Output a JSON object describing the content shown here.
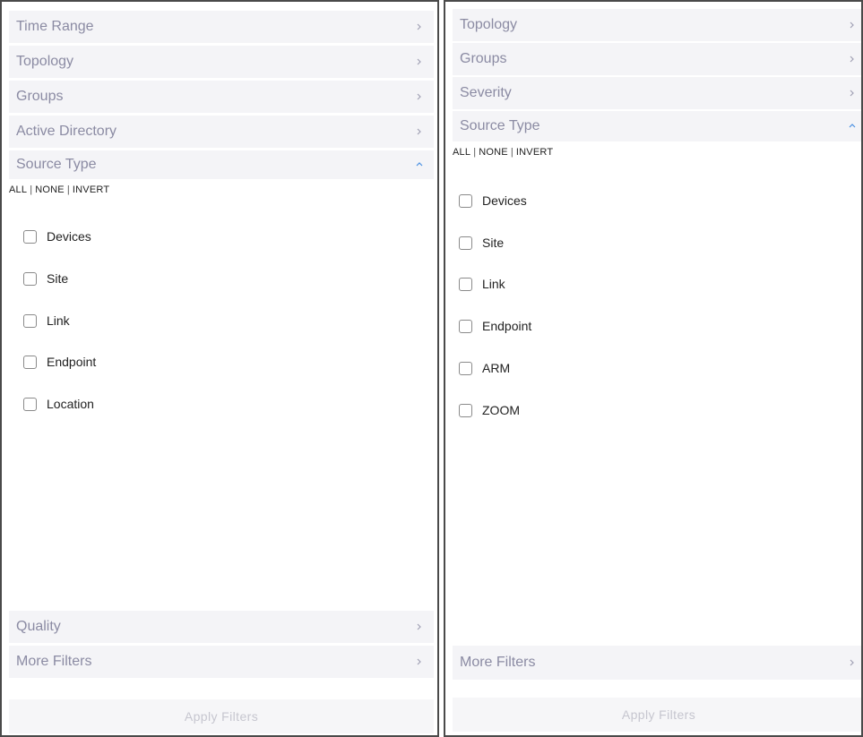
{
  "left": {
    "sections_top": [
      {
        "label": "Time Range",
        "expanded": false
      },
      {
        "label": "Topology",
        "expanded": false
      },
      {
        "label": "Groups",
        "expanded": false
      },
      {
        "label": "Active Directory",
        "expanded": false
      },
      {
        "label": "Source Type",
        "expanded": true
      }
    ],
    "bulk": {
      "all": "ALL",
      "sep": "|",
      "none": "NONE",
      "invert": "INVERT"
    },
    "options": [
      "Devices",
      "Site",
      "Link",
      "Endpoint",
      "Location"
    ],
    "sections_bottom": [
      {
        "label": "Quality",
        "expanded": false
      },
      {
        "label": "More Filters",
        "expanded": false
      }
    ],
    "apply_label": "Apply Filters"
  },
  "right": {
    "sections_top": [
      {
        "label": "Topology",
        "expanded": false
      },
      {
        "label": "Groups",
        "expanded": false
      },
      {
        "label": "Severity",
        "expanded": false
      },
      {
        "label": "Source Type",
        "expanded": true
      }
    ],
    "bulk": {
      "all": "ALL",
      "sep": "|",
      "none": "NONE",
      "invert": "INVERT"
    },
    "options": [
      "Devices",
      "Site",
      "Link",
      "Endpoint",
      "ARM",
      "ZOOM"
    ],
    "sections_bottom": [
      {
        "label": "More Filters",
        "expanded": false
      }
    ],
    "apply_label": "Apply Filters"
  },
  "colors": {
    "header_bg": "#f4f4f7",
    "header_text": "#8b8ba3",
    "chevron": "#a0a0b4",
    "chevron_active": "#4a90e2"
  },
  "icons": {
    "collapsed": "chevron-right-icon",
    "expanded": "chevron-up-icon"
  }
}
